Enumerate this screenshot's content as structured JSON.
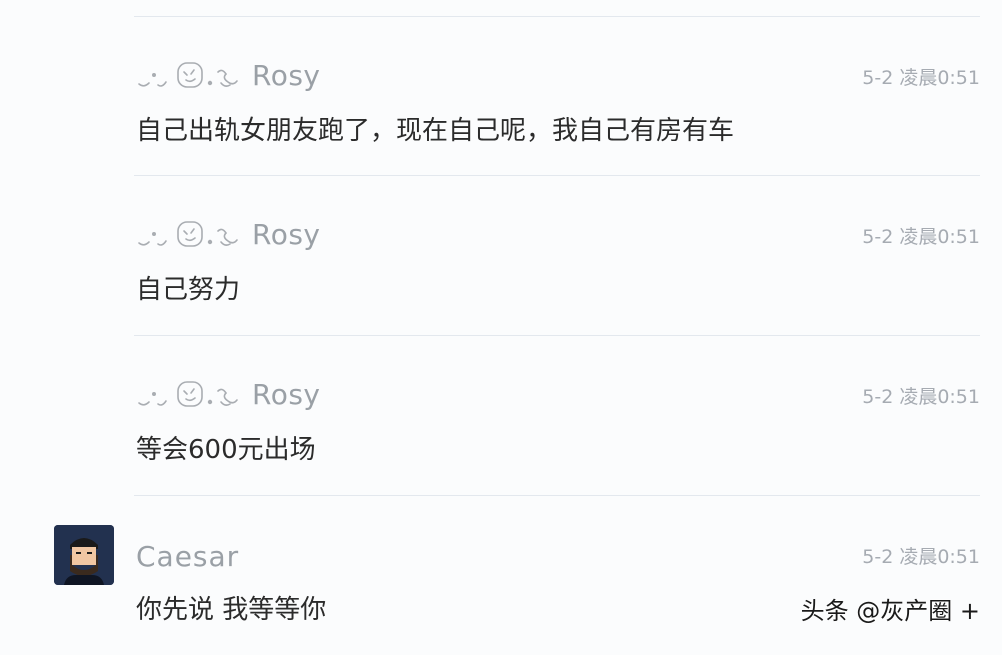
{
  "messages": [
    {
      "sender": "Rosy",
      "time": "5-2 凌晨0:51",
      "text": "自己出轨女朋友跑了，现在自己呢，我自己有房有车"
    },
    {
      "sender": "Rosy",
      "time": "5-2 凌晨0:51",
      "text": "自己努力"
    },
    {
      "sender": "Rosy",
      "time": "5-2 凌晨0:51",
      "text": "等会600元出场"
    },
    {
      "sender": "Caesar",
      "time": "5-2 凌晨0:51",
      "text": "你先说 我等等你"
    }
  ],
  "watermark": "头条 @灰产圈 +",
  "icons": {
    "name_decoration": "doodle-decoration-icon",
    "avatar": "bearded-man-avatar"
  }
}
